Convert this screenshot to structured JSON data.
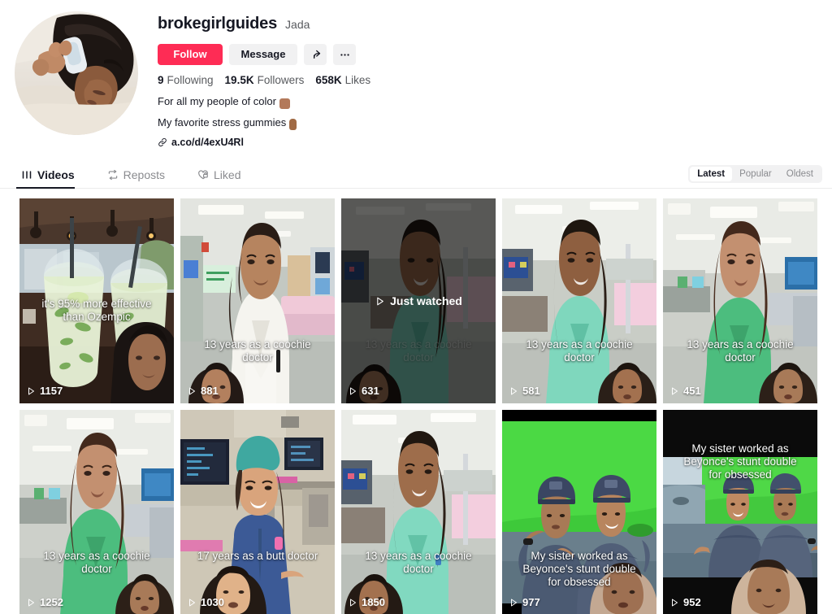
{
  "profile": {
    "username": "brokegirlguides",
    "nickname": "Jada",
    "avatar_icon": "profile-photo",
    "buttons": {
      "follow": "Follow",
      "message": "Message",
      "share_icon": "share-arrow-icon",
      "more_icon": "more-options-icon"
    },
    "stats": [
      {
        "value": "9",
        "label": "Following"
      },
      {
        "value": "19.5K",
        "label": "Followers"
      },
      {
        "value": "658K",
        "label": "Likes"
      }
    ],
    "bio": [
      {
        "text": "For all my people of color",
        "emoji": "fist-bump-emoji"
      },
      {
        "text": "My favorite stress gummies",
        "emoji": "pointing-down-emoji"
      }
    ],
    "link": {
      "icon": "link-chain-icon",
      "text": "a.co/d/4exU4Rl"
    }
  },
  "tabs": [
    {
      "label": "Videos",
      "icon": "grid-icon",
      "active": true
    },
    {
      "label": "Reposts",
      "icon": "repost-icon",
      "active": false
    },
    {
      "label": "Liked",
      "icon": "heart-lock-icon",
      "active": false
    }
  ],
  "sort_options": [
    {
      "label": "Latest",
      "active": true
    },
    {
      "label": "Popular",
      "active": false
    },
    {
      "label": "Oldest",
      "active": false
    }
  ],
  "videos": [
    {
      "caption": "it's 95% more effective\nthan Ozempic",
      "views": "1157",
      "caption_position": "mid",
      "watched": false,
      "watched_label": "",
      "theme": "drinks-patio"
    },
    {
      "caption": "13 years as a coochie\ndoctor",
      "views": "881",
      "caption_position": "low",
      "watched": false,
      "watched_label": "",
      "theme": "hospital-white-coat"
    },
    {
      "caption": "13 years as a coochie\ndoctor",
      "views": "631",
      "caption_position": "low",
      "watched": true,
      "watched_label": "Just watched",
      "theme": "hospital-teal-scrubs-dark"
    },
    {
      "caption": "13 years as a coochie\ndoctor",
      "views": "581",
      "caption_position": "low",
      "watched": false,
      "watched_label": "",
      "theme": "hospital-mint-scrubs"
    },
    {
      "caption": "13 years as a coochie\ndoctor",
      "views": "451",
      "caption_position": "low",
      "watched": false,
      "watched_label": "",
      "theme": "hospital-green-scrubs"
    },
    {
      "caption": "13 years as a coochie\ndoctor",
      "views": "1252",
      "caption_position": "low",
      "watched": false,
      "watched_label": "",
      "theme": "hospital-green-scrubs"
    },
    {
      "caption": "17 years as a butt doctor",
      "views": "1030",
      "caption_position": "low",
      "watched": false,
      "watched_label": "",
      "theme": "operating-room-blue-scrubs"
    },
    {
      "caption": "13 years as a coochie\ndoctor",
      "views": "1850",
      "caption_position": "low",
      "watched": false,
      "watched_label": "",
      "theme": "hospital-mint-scrubs"
    },
    {
      "caption": "My sister worked as\nBeyonce's stunt double\nfor obsessed",
      "views": "977",
      "caption_position": "low",
      "watched": false,
      "watched_label": "",
      "theme": "green-screen-navy-uniforms"
    },
    {
      "caption": "My sister worked as\nBeyonce's stunt double\nfor obsessed",
      "views": "952",
      "caption_position": "high",
      "watched": false,
      "watched_label": "",
      "theme": "green-screen-outdoor-letterbox"
    }
  ],
  "colors": {
    "accent": "#fe2c55",
    "text_primary": "#161823",
    "text_secondary": "#585a5e",
    "chip_bg": "#f1f1f2"
  }
}
